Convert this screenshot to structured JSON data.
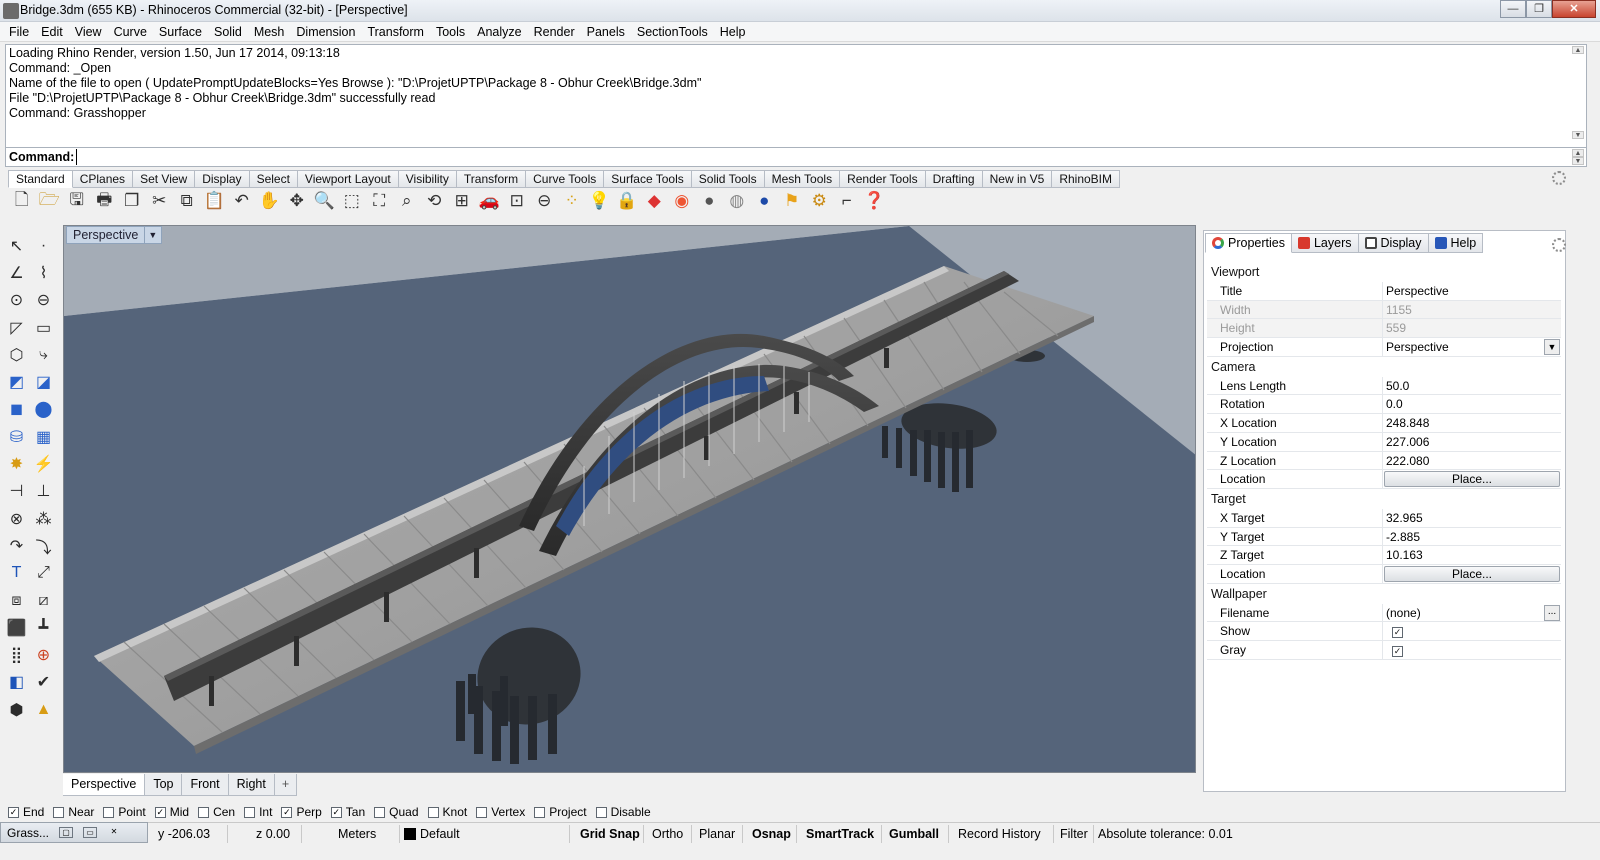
{
  "window": {
    "title": "Bridge.3dm (655 KB) - Rhinoceros Commercial (32-bit) - [Perspective]",
    "minimize": "—",
    "restore": "❐",
    "close": "✕"
  },
  "menu": [
    "File",
    "Edit",
    "View",
    "Curve",
    "Surface",
    "Solid",
    "Mesh",
    "Dimension",
    "Transform",
    "Tools",
    "Analyze",
    "Render",
    "Panels",
    "SectionTools",
    "Help"
  ],
  "history": [
    "Loading Rhino Render, version 1.50, Jun 17 2014, 09:13:18",
    "Command: _Open",
    "Name of the file to open ( UpdatePromptUpdateBlocks=Yes  Browse ): \"D:\\ProjetUPTP\\Package 8 - Obhur Creek\\Bridge.3dm\"",
    "File \"D:\\ProjetUPTP\\Package 8 - Obhur Creek\\Bridge.3dm\" successfully read",
    "Command: Grasshopper"
  ],
  "command": {
    "label": "Command:",
    "value": ""
  },
  "toolbar_tabs": [
    "Standard",
    "CPlanes",
    "Set View",
    "Display",
    "Select",
    "Viewport Layout",
    "Visibility",
    "Transform",
    "Curve Tools",
    "Surface Tools",
    "Solid Tools",
    "Mesh Tools",
    "Render Tools",
    "Drafting",
    "New in V5",
    "RhinoBIM"
  ],
  "viewport": {
    "name": "Perspective",
    "tabs": [
      "Perspective",
      "Top",
      "Front",
      "Right"
    ],
    "add_tab": "+"
  },
  "properties": {
    "tabs": [
      "Properties",
      "Layers",
      "Display",
      "Help"
    ],
    "sections": {
      "viewport": "Viewport",
      "camera": "Camera",
      "target": "Target",
      "wallpaper": "Wallpaper"
    },
    "viewport_rows": [
      {
        "key": "Title",
        "value": "Perspective"
      },
      {
        "key": "Width",
        "value": "1155"
      },
      {
        "key": "Height",
        "value": "559"
      },
      {
        "key": "Projection",
        "value": "Perspective"
      }
    ],
    "camera_rows": [
      {
        "key": "Lens Length",
        "value": "50.0"
      },
      {
        "key": "Rotation",
        "value": "0.0"
      },
      {
        "key": "X Location",
        "value": "248.848"
      },
      {
        "key": "Y Location",
        "value": "227.006"
      },
      {
        "key": "Z Location",
        "value": "222.080"
      },
      {
        "key": "Location",
        "value": "Place..."
      }
    ],
    "target_rows": [
      {
        "key": "X Target",
        "value": "32.965"
      },
      {
        "key": "Y Target",
        "value": "-2.885"
      },
      {
        "key": "Z Target",
        "value": "10.163"
      },
      {
        "key": "Location",
        "value": "Place..."
      }
    ],
    "wallpaper_rows": [
      {
        "key": "Filename",
        "value": "(none)"
      },
      {
        "key": "Show",
        "value": "✓"
      },
      {
        "key": "Gray",
        "value": "✓"
      }
    ]
  },
  "osnaps": [
    {
      "label": "End",
      "checked": "✓"
    },
    {
      "label": "Near",
      "checked": ""
    },
    {
      "label": "Point",
      "checked": ""
    },
    {
      "label": "Mid",
      "checked": "✓"
    },
    {
      "label": "Cen",
      "checked": ""
    },
    {
      "label": "Int",
      "checked": ""
    },
    {
      "label": "Perp",
      "checked": "✓"
    },
    {
      "label": "Tan",
      "checked": "✓"
    },
    {
      "label": "Quad",
      "checked": ""
    },
    {
      "label": "Knot",
      "checked": ""
    },
    {
      "label": "Vertex",
      "checked": ""
    },
    {
      "label": "Project",
      "checked": ""
    },
    {
      "label": "Disable",
      "checked": ""
    }
  ],
  "statusbar": {
    "grasshopper": "Grass...",
    "y": "y -206.03",
    "z": "z 0.00",
    "units": "Meters",
    "layer": "Default",
    "grid_snap": "Grid Snap",
    "ortho": "Ortho",
    "planar": "Planar",
    "osnap": "Osnap",
    "smarttrack": "SmartTrack",
    "gumball": "Gumball",
    "record_history": "Record History",
    "filter": "Filter",
    "tolerance": "Absolute tolerance: 0.01"
  },
  "colors": {
    "viewport_bg": "#a4acb6",
    "water": "#55647a",
    "deck": "#a6a6a6",
    "dark_deck": "#3c3c3c",
    "arch_blue": "#304d80"
  }
}
